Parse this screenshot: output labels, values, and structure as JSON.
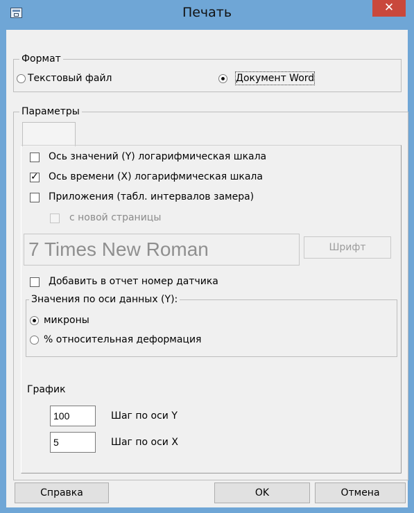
{
  "window": {
    "title": "Печать",
    "close_glyph": "✕"
  },
  "format": {
    "legend": "Формат",
    "options": [
      {
        "label": "Текстовый файл",
        "selected": false
      },
      {
        "label": "Документ Word",
        "selected": true
      }
    ]
  },
  "params": {
    "legend": "Параметры",
    "checks": [
      {
        "label": "Ось значений (Y) логарифмическая шкала",
        "checked": false
      },
      {
        "label": "Ось времени (X) логарифмическая шкала",
        "checked": true
      },
      {
        "label": "Приложения (табл. интервалов замера)",
        "checked": false
      },
      {
        "label": "с новой страницы",
        "checked": false,
        "disabled": true
      }
    ],
    "font_preview": "7 Times New Roman",
    "font_button": "Шрифт",
    "sensor_check": {
      "label": "Добавить в отчет номер датчика",
      "checked": false
    },
    "y_units": {
      "legend": "Значения по оси данных (Y):",
      "options": [
        {
          "label": "микроны",
          "selected": true
        },
        {
          "label": "% относительная деформация",
          "selected": false
        }
      ]
    },
    "graph": {
      "label": "График",
      "y_step": {
        "value": "100",
        "label": "Шаг по оси Y"
      },
      "x_step": {
        "value": "5",
        "label": "Шаг по оси X"
      }
    }
  },
  "buttons": {
    "help": "Справка",
    "ok": "OK",
    "cancel": "Отмена"
  }
}
